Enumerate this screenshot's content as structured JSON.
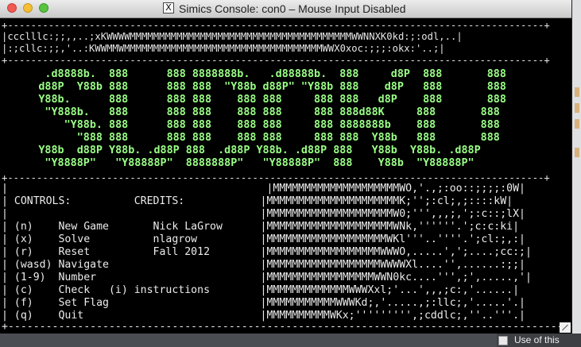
{
  "window": {
    "title": "Simics Console: con0 – Mouse Input Disabled",
    "x_icon": "X"
  },
  "console": {
    "rule_top": "+--------------------------------------------------------------------------------------------+",
    "noise1": "|ccclllc:;;,,..;xKWWWWMMMMMMMMMMMMMMMMMMMMMMMMMMMMMMMMMMMMMMWWNNXK0kd:;:odl,..|",
    "noise2": "|:;cllc:;;,'..:KWWMMWMMMMMMMMMMMMMMMMMMMMMMMMMMMMMMMMMMWWX0xoc:;;;:okx:'..;|",
    "rule_mid": "+--------------------------------------------------------------------------------------------+",
    "art": [
      "       .d8888b.  888      888 8888888b.   .d88888b.  888     d8P  888       888",
      "      d88P  Y88b 888      888 888  \"Y88b d88P\" \"Y88b 888    d8P   888       888",
      "      Y88b.      888      888 888    888 888     888 888   d8P    888       888",
      "       \"Y888b.   888      888 888    888 888     888 888d88K     888       888",
      "          \"Y88b. 888      888 888    888 888     888 8888888b    888       888",
      "            \"888 888      888 888    888 888     888 888  Y88b   888       888",
      "      Y88b  d88P Y88b. .d88P 888  .d88P Y88b. .d88P 888   Y88b  Y88b. .d88P",
      "       \"Y8888P\"   \"Y88888P\"  8888888P\"   \"Y88888P\"  888    Y88b  \"Y88888P\""
    ],
    "rule_bottom": "+--------------------------------------------------------------------------------------------+",
    "panel": [
      "|                                         |MMMMMMMMMMMMMMMMMMMMWO,'.,;:oo::;;;;:0W|",
      "| CONTROLS:          CREDITS:            |MMMMMMMMMMMMMMMMMMMMMK;'';:cl;,;::::kW|",
      "|                                        |MMMMMMMMMMMMMMMMMMMMW0;''',,,;,';:c::;lX|",
      "| (n)    New Game       Nick LaGrow      |MMMMMMMMMMMMMMMMMMMMWNk,''''''.';c:c:ki|",
      "| (x)    Solve          nlagrow          |MMMMMMMMMMMMMMMMMMMWKl'''..''''.';cl:;,:|",
      "| (r)    Reset          Fall 2012        |MMMMMMMMMMMMMMMMMMWWWO,.....',';....;cc:;|",
      "| (wasd) Navigate                        |MMMMMMMMMMMMMMMMMMWWWWXl....'',......:;;|",
      "| (1-9)  Number                          |MMMMMMMMMMMMMMMMMWWN0kc....''',;',.....,'|",
      "| (c)    Check   (i) instructions        |MMMMMMMMMMMMMWWWXxl;'...',,,;c:,'......|",
      "| (f)    Set Flag                        |MMMMMMMMMMMWWWKd;,'.....,;:llc;,'.....'.|",
      "| (q)    Quit                            |MMMMMMMMMMWKx;''''''''',;cddlc;,''..'''.|",
      "+--------------------------------------------------------------------------------------------+"
    ]
  },
  "background": {
    "checkbox_label": "Use of this"
  }
}
